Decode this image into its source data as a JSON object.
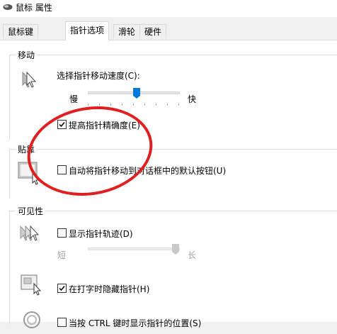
{
  "window": {
    "title": "鼠标 属性"
  },
  "tabs": [
    {
      "label": "鼠标键"
    },
    {
      "label": "指针选项"
    },
    {
      "label": "滑轮"
    },
    {
      "label": "硬件"
    }
  ],
  "motion": {
    "group_title": "移动",
    "speed_label": "选择指针移动速度(C):",
    "slow_label": "慢",
    "fast_label": "快",
    "speed_value_percent": 53,
    "enhance_label": "提高指针精确度(E)",
    "enhance_checked": true
  },
  "snap": {
    "group_title": "贴靠",
    "snap_label": "自动将指针移动到对话框中的默认按钮(U)",
    "snap_checked": false
  },
  "visibility": {
    "group_title": "可见性",
    "trails_label": "显示指针轨迹(D)",
    "trails_checked": false,
    "short_label": "短",
    "long_label": "长",
    "trail_value_percent": 100,
    "hide_label": "在打字时隐藏指针(H)",
    "hide_checked": true,
    "ctrl_label": "当按 CTRL 键时显示指针的位置(S)"
  },
  "colors": {
    "annotation": "#e02020",
    "accent": "#0078d7"
  }
}
